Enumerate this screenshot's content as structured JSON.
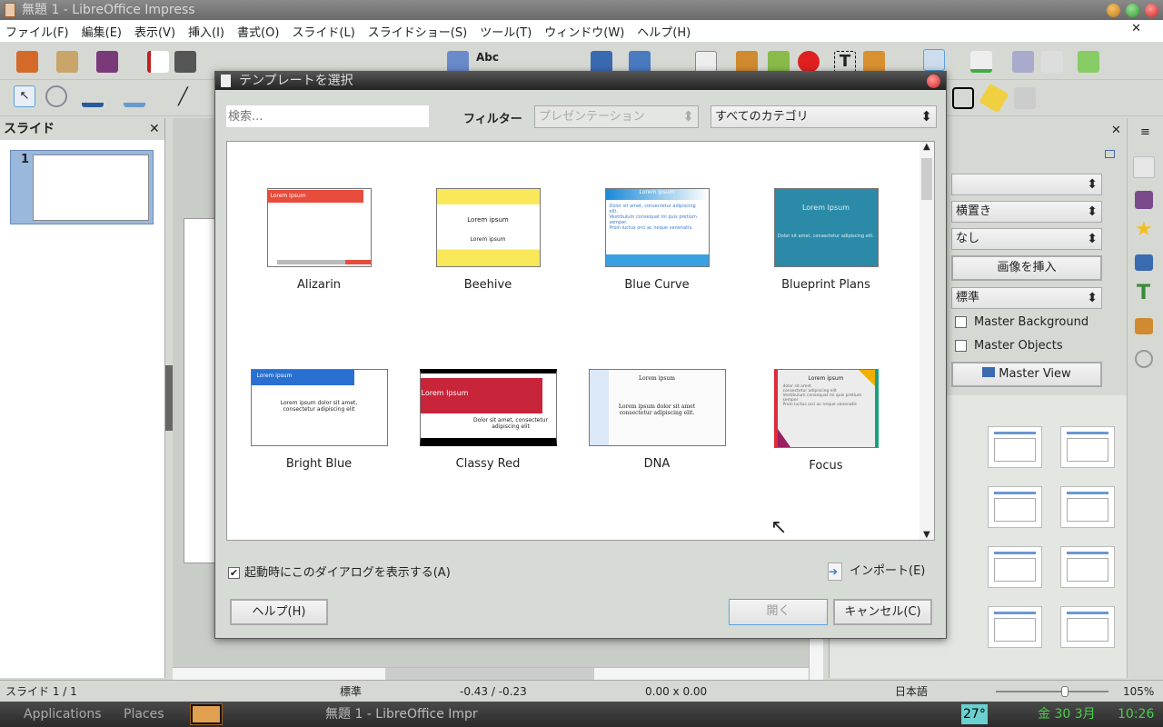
{
  "window": {
    "title": "無題 1 - LibreOffice Impress"
  },
  "menu": [
    "ファイル(F)",
    "編集(E)",
    "表示(V)",
    "挿入(I)",
    "書式(O)",
    "スライド(L)",
    "スライドショー(S)",
    "ツール(T)",
    "ウィンドウ(W)",
    "ヘルプ(H)"
  ],
  "slides_panel": {
    "title": "スライド",
    "slide_number": "1"
  },
  "right_panel": {
    "select1": "",
    "orientation": "横置き",
    "background": "なし",
    "insert_image": "画像を挿入",
    "master": "標準",
    "master_background": "Master Background",
    "master_objects": "Master Objects",
    "master_view": "Master View"
  },
  "dialog": {
    "title": "テンプレートを選択",
    "search_placeholder": "検索...",
    "filter_label": "フィルター",
    "filter_value": "プレゼンテーション",
    "category_value": "すべてのカテゴリ",
    "templates": [
      {
        "name": "Alizarin",
        "thumb_title": "Lorem Ipsum"
      },
      {
        "name": "Beehive",
        "thumb_title": "Lorem ipsum",
        "thumb_sub": "Lorem ipsum"
      },
      {
        "name": "Blue Curve",
        "thumb_title": "Lorem Ipsum",
        "thumb_lines": [
          "Dolor sit amet, consectetur adipiscing elit.",
          "Vestibulum consequat mi quis pretium semper.",
          "Proin luctus orci ac neque venenatis."
        ]
      },
      {
        "name": "Blueprint Plans",
        "thumb_title": "Lorem Ipsum",
        "thumb_sub": "Dolor sit amet, consectetur adipiscing elit."
      },
      {
        "name": "Bright Blue",
        "thumb_title": "Lorem ipsum",
        "thumb_sub": "Lorem ipsum dolor sit amet, consectetur adipiscing elit"
      },
      {
        "name": "Classy Red",
        "thumb_title": "Lorem Ipsum",
        "thumb_sub": "Dolor sit amet, consectetur adipiscing elit"
      },
      {
        "name": "DNA",
        "thumb_title": "Lorem ipsum",
        "thumb_sub": "Lorem ipsum dolor sit amet consectetur adipiscing elit."
      },
      {
        "name": "Focus",
        "thumb_title": "Lorem ipsum",
        "thumb_lines": [
          "dolor sit amet",
          "consectetur adipiscing elit",
          "Vestibulum consequat mi quis pretium semper",
          "Proin luctus orci ac neque venenatis"
        ]
      }
    ],
    "show_on_startup": "起動時にこのダイアログを表示する(A)",
    "show_on_startup_checked": true,
    "import": "インポート(E)",
    "help": "ヘルプ(H)",
    "open": "開く",
    "cancel": "キャンセル(C)"
  },
  "statusbar": {
    "slide": "スライド 1 / 1",
    "master": "標準",
    "position": "-0.43 / -0.23",
    "size": "0.00 x 0.00",
    "language": "日本語",
    "zoom": "105%",
    "zoom_fraction": 0.55
  },
  "taskbar": {
    "applications": "Applications",
    "places": "Places",
    "task": "無題 1 - LibreOffice Impr",
    "temp": "27°",
    "date": "金 30  3月",
    "time": "10:26"
  }
}
